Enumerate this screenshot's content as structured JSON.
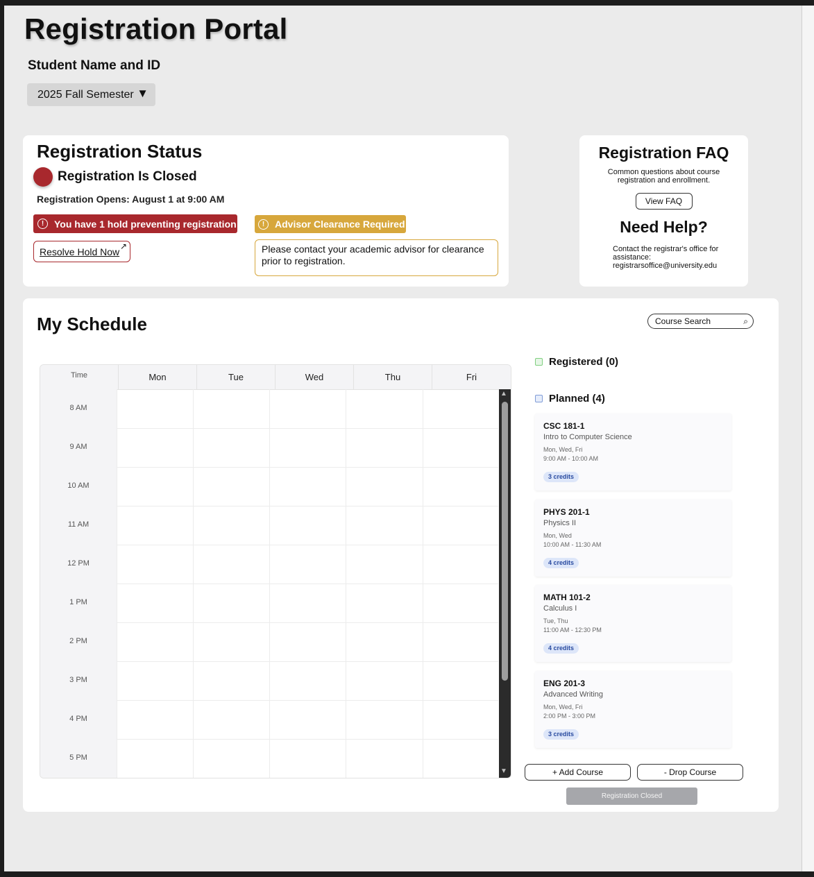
{
  "header": {
    "title": "Registration Portal",
    "student": "Student Name and ID",
    "semester": "2025 Fall Semester"
  },
  "status": {
    "title": "Registration Status",
    "state": "Registration Is Closed",
    "opens": "Registration Opens: August  1 at 9:00 AM",
    "hold_banner": "You have 1 hold preventing registration",
    "resolve_button": "Resolve Hold Now",
    "advisor_banner": "Advisor Clearance Required",
    "advisor_message": "Please contact your academic advisor for clearance prior to registration.",
    "colors": {
      "hold": "#a8282d",
      "advisor": "#d7a73c"
    }
  },
  "faq": {
    "title": "Registration FAQ",
    "description": "Common questions about course registration and enrollment.",
    "button": "View FAQ",
    "help_title": "Need Help?",
    "help_text": "Contact the registrar's office for assistance: registrarsoffice@university.edu"
  },
  "schedule": {
    "title": "My Schedule",
    "search_placeholder": "Course Search",
    "time_header": "Time",
    "days": [
      "Mon",
      "Tue",
      "Wed",
      "Thu",
      "Fri"
    ],
    "times": [
      "8 AM",
      "9 AM",
      "10 AM",
      "11 AM",
      "12 PM",
      "1 PM",
      "2 PM",
      "3 PM",
      "4 PM",
      "5 PM"
    ],
    "registered_label": "Registered (0)",
    "planned_label": "Planned (4)",
    "courses": [
      {
        "code": "CSC 181-1",
        "name": "Intro to Computer Science",
        "days": "Mon, Wed, Fri",
        "time": "9:00 AM - 10:00 AM",
        "credits": "3 credits"
      },
      {
        "code": "PHYS 201-1",
        "name": "Physics II",
        "days": "Mon, Wed",
        "time": "10:00 AM - 11:30 AM",
        "credits": "4 credits"
      },
      {
        "code": "MATH 101-2",
        "name": "Calculus I",
        "days": "Tue, Thu",
        "time": "11:00 AM - 12:30 PM",
        "credits": "4 credits"
      },
      {
        "code": "ENG 201-3",
        "name": "Advanced Writing",
        "days": "Mon, Wed, Fri",
        "time": "2:00 PM - 3:00 PM",
        "credits": "3 credits"
      }
    ],
    "add_button": "+  Add Course",
    "drop_button": "-   Drop Course",
    "closed_button": "Registration Closed"
  }
}
